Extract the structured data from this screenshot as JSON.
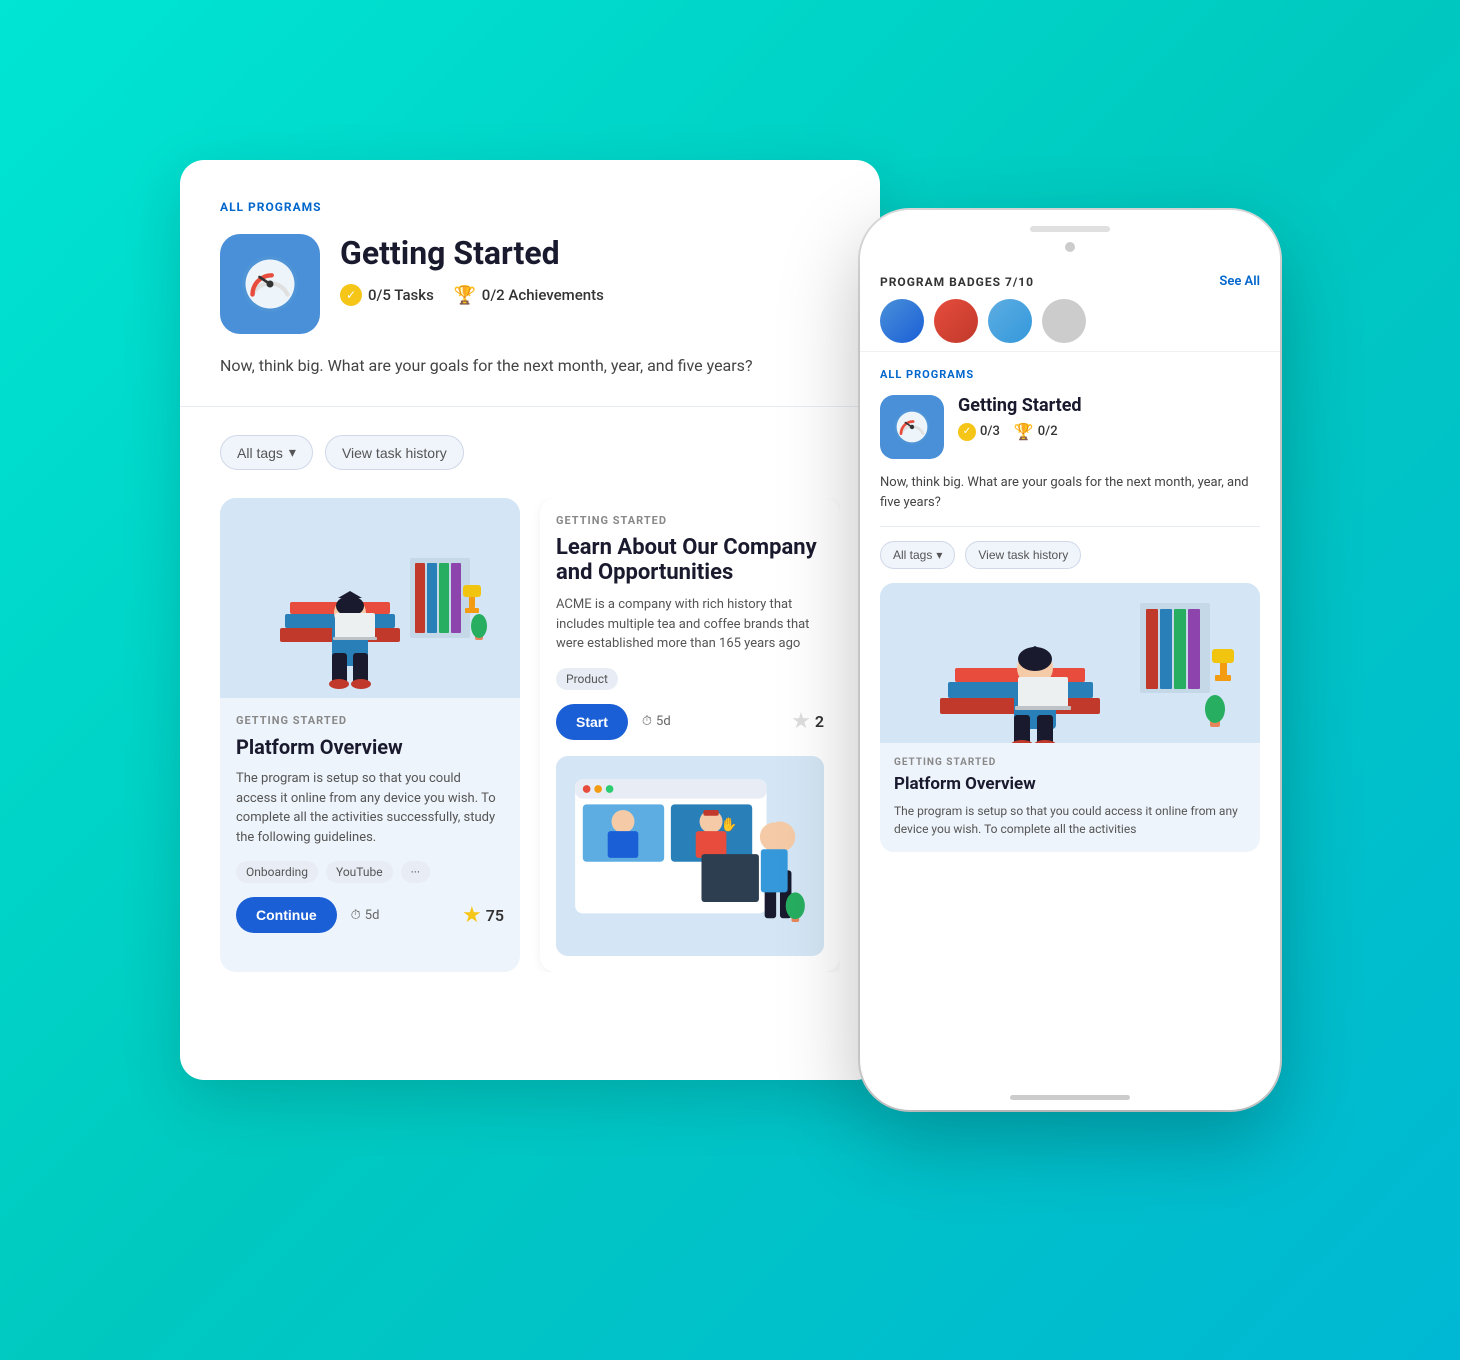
{
  "desktop": {
    "all_programs_label": "ALL PROGRAMS",
    "program_title": "Getting Started",
    "tasks_stat": "0/5 Tasks",
    "achievements_stat": "0/2 Achievements",
    "description": "Now, think big. What are your goals for the next month, year, and five years?",
    "filter_tags_label": "All tags",
    "filter_history_label": "View task history",
    "card1": {
      "category": "GETTING STARTED",
      "title": "Platform Overview",
      "description": "The program is setup so that you could access it online from any device you wish. To complete all the activities successfully, study the following guidelines.",
      "tags": [
        "Onboarding",
        "YouTube",
        "..."
      ],
      "continue_label": "Continue",
      "time": "5d",
      "rating": "75"
    },
    "card2": {
      "category": "GETTING STARTED",
      "title": "Learn About Our Company and Opportunities",
      "description": "ACME is a company with rich history that includes multiple tea and coffee brands that were established more than 165 years ago",
      "tags": [
        "Product"
      ],
      "start_label": "Start",
      "time": "5d",
      "rating": "2"
    }
  },
  "phone": {
    "badges_title": "PROGRAM BADGES",
    "badges_count": "7/10",
    "see_all_label": "See All",
    "all_programs_label": "ALL PROGRAMS",
    "program_title": "Getting Started",
    "tasks_stat": "0/3",
    "achievements_stat": "0/2",
    "description": "Now, think big. What are your goals for the next month, year, and five years?",
    "filter_tags_label": "All tags",
    "filter_history_label": "View task history",
    "card1": {
      "category": "GETTING STARTED",
      "title": "Platform Overview",
      "description": "The program is setup so that you could access it online from any device you wish. To complete all the activities"
    }
  },
  "icons": {
    "check": "✓",
    "trophy": "🏆",
    "clock": "⏱",
    "star": "★",
    "chevron_down": "▾"
  }
}
